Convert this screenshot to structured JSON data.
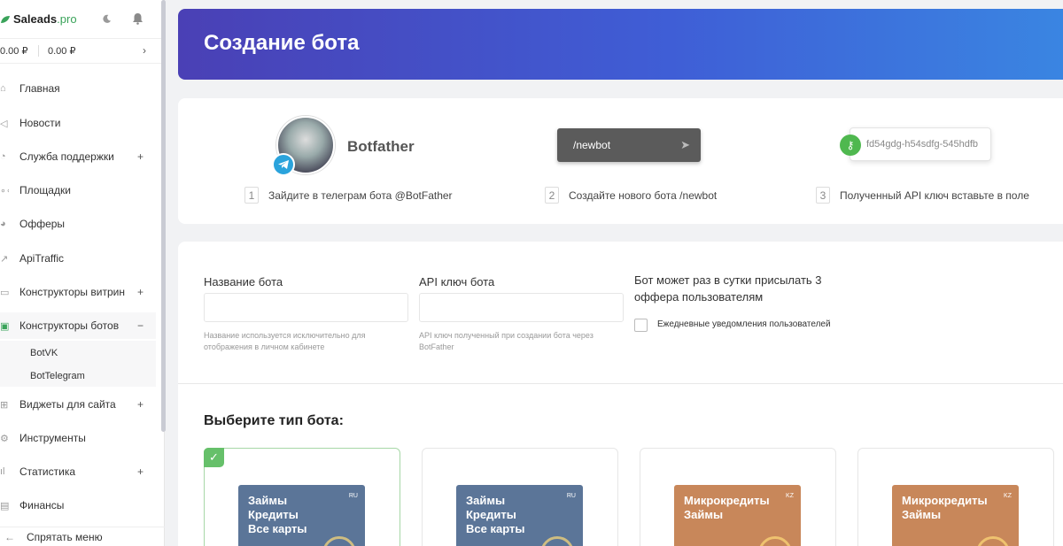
{
  "sidebar": {
    "logo_main": "Saleads",
    "logo_suffix": ".pro",
    "balance_1": "0.00 ₽",
    "balance_2": "0.00 ₽",
    "items": [
      {
        "label": "Главная",
        "icon": "home-icon"
      },
      {
        "label": "Новости",
        "icon": "megaphone-icon"
      },
      {
        "label": "Служба поддержки",
        "icon": "support-icon",
        "expand": "+"
      },
      {
        "label": "Площадки",
        "icon": "sites-icon"
      },
      {
        "label": "Офферы",
        "icon": "offers-icon"
      },
      {
        "label": "ApiTraffic",
        "icon": "api-icon"
      },
      {
        "label": "Конструкторы витрин",
        "icon": "showcase-icon",
        "expand": "+"
      },
      {
        "label": "Конструкторы ботов",
        "icon": "bot-icon",
        "expand": "−"
      },
      {
        "label": "Виджеты для сайта",
        "icon": "widget-icon",
        "expand": "+"
      },
      {
        "label": "Инструменты",
        "icon": "tools-icon"
      },
      {
        "label": "Статистика",
        "icon": "stats-icon",
        "expand": "+"
      },
      {
        "label": "Финансы",
        "icon": "finance-icon"
      }
    ],
    "sub_items": [
      "BotVK",
      "BotTelegram"
    ],
    "hide_menu": "Спрятать меню"
  },
  "header": {
    "title": "Создание бота"
  },
  "steps": {
    "botfather_name": "Botfather",
    "command": "/newbot",
    "api_key_sample": "fd54gdg-h54sdfg-545hdfb",
    "items": [
      {
        "num": "1",
        "text": "Зайдите в телеграм бота @BotFather"
      },
      {
        "num": "2",
        "text": "Создайте нового бота /newbot"
      },
      {
        "num": "3",
        "text": "Полученный API ключ вставьте в поле"
      }
    ]
  },
  "form": {
    "name_label": "Название бота",
    "name_value": "",
    "name_hint": "Название используется исключительно для отображения в личном кабинете",
    "api_label": "API ключ бота",
    "api_value": "",
    "api_hint": "API ключ полученный при создании бота через BotFather",
    "daily_title": "Бот может раз в сутки присылать 3 оффера пользователям",
    "daily_checkbox": "Ежедневные уведомления пользователей"
  },
  "bot_types": {
    "title": "Выберите тип бота:",
    "cards": [
      {
        "lines": [
          "Займы",
          "Кредиты",
          "Все карты"
        ],
        "country": "RU",
        "selected": true
      },
      {
        "lines": [
          "Займы",
          "Кредиты",
          "Все карты"
        ],
        "country": "RU",
        "selected": false
      },
      {
        "lines": [
          "Микрокредиты",
          "Займы"
        ],
        "country": "KZ",
        "selected": false
      },
      {
        "lines": [
          "Микрокредиты",
          "Займы"
        ],
        "country": "KZ",
        "selected": false
      }
    ]
  },
  "colors": {
    "header_start": "#4a40b5",
    "header_end": "#3a86e2",
    "accent_green": "#66c06a",
    "telegram_blue": "#2aa3dc"
  }
}
